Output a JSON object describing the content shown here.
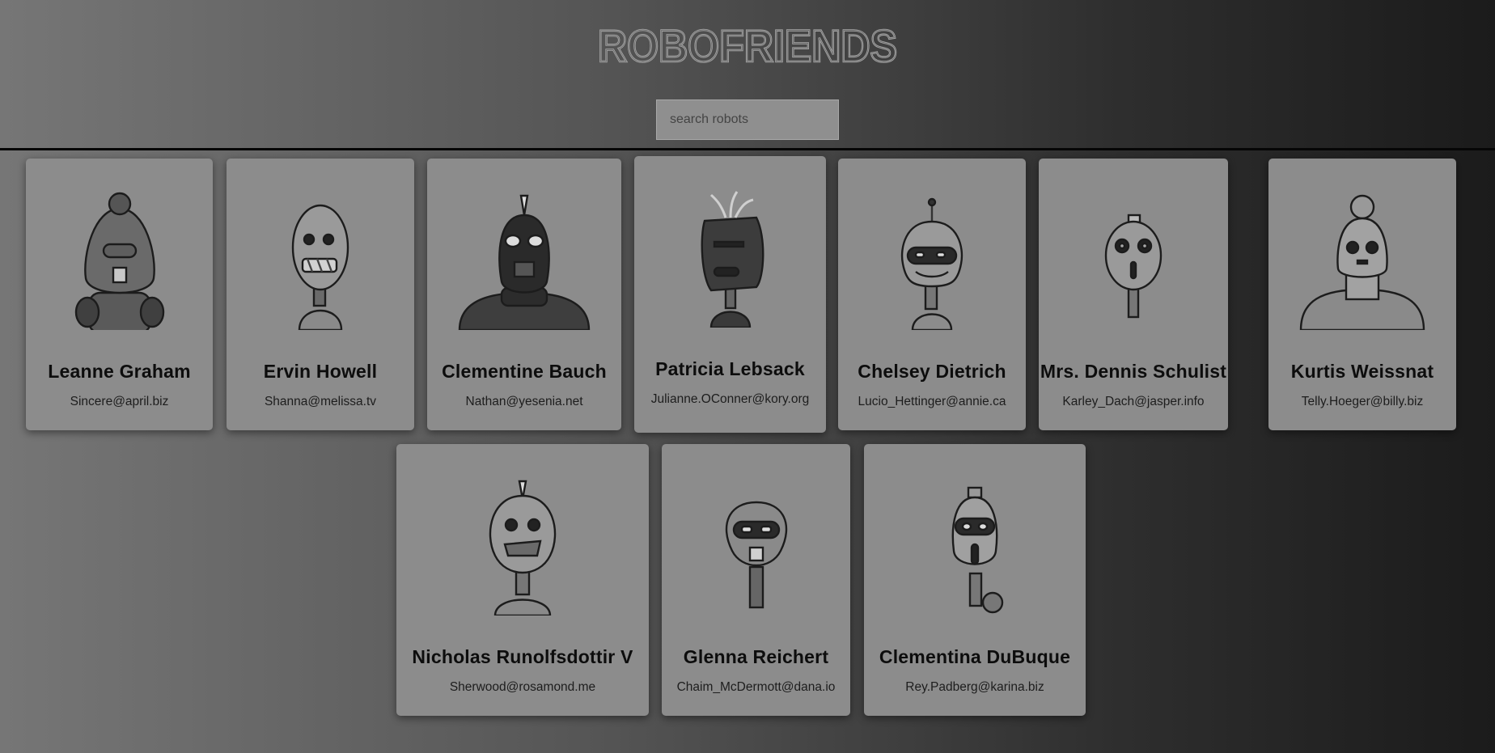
{
  "header": {
    "logo_text": "ROBOFRIENDS",
    "search_placeholder": "search robots"
  },
  "robots": [
    {
      "name": "Leanne Graham",
      "email": "Sincere@april.biz"
    },
    {
      "name": "Ervin Howell",
      "email": "Shanna@melissa.tv"
    },
    {
      "name": "Clementine Bauch",
      "email": "Nathan@yesenia.net"
    },
    {
      "name": "Patricia Lebsack",
      "email": "Julianne.OConner@kory.org"
    },
    {
      "name": "Chelsey Dietrich",
      "email": "Lucio_Hettinger@annie.ca"
    },
    {
      "name": "Mrs. Dennis Schulist",
      "email": "Karley_Dach@jasper.info"
    },
    {
      "name": "Kurtis Weissnat",
      "email": "Telly.Hoeger@billy.biz"
    },
    {
      "name": "Nicholas Runolfsdottir V",
      "email": "Sherwood@rosamond.me"
    },
    {
      "name": "Glenna Reichert",
      "email": "Chaim_McDermott@dana.io"
    },
    {
      "name": "Clementina DuBuque",
      "email": "Rey.Padberg@karina.biz"
    }
  ]
}
